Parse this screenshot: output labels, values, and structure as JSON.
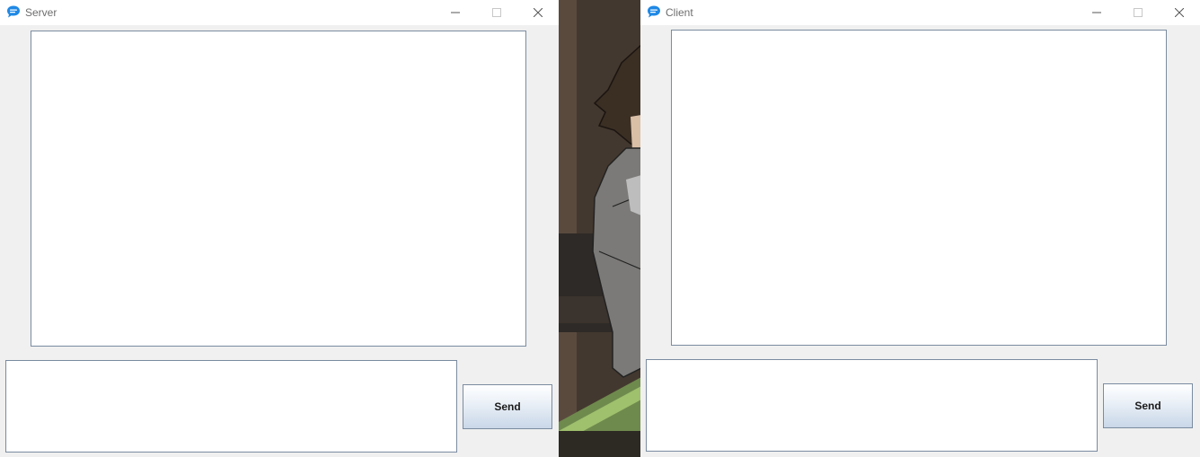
{
  "server_window": {
    "title": "Server",
    "icon": "chat-bubble-icon",
    "chat_log": "",
    "message_input": "",
    "send_label": "Send"
  },
  "client_window": {
    "title": "Client",
    "icon": "chat-bubble-icon",
    "chat_log": "",
    "message_input": "",
    "send_label": "Send"
  },
  "colors": {
    "window_bg": "#f0f0f0",
    "icon_blue": "#1e88e5",
    "border": "#7a8ba0"
  }
}
